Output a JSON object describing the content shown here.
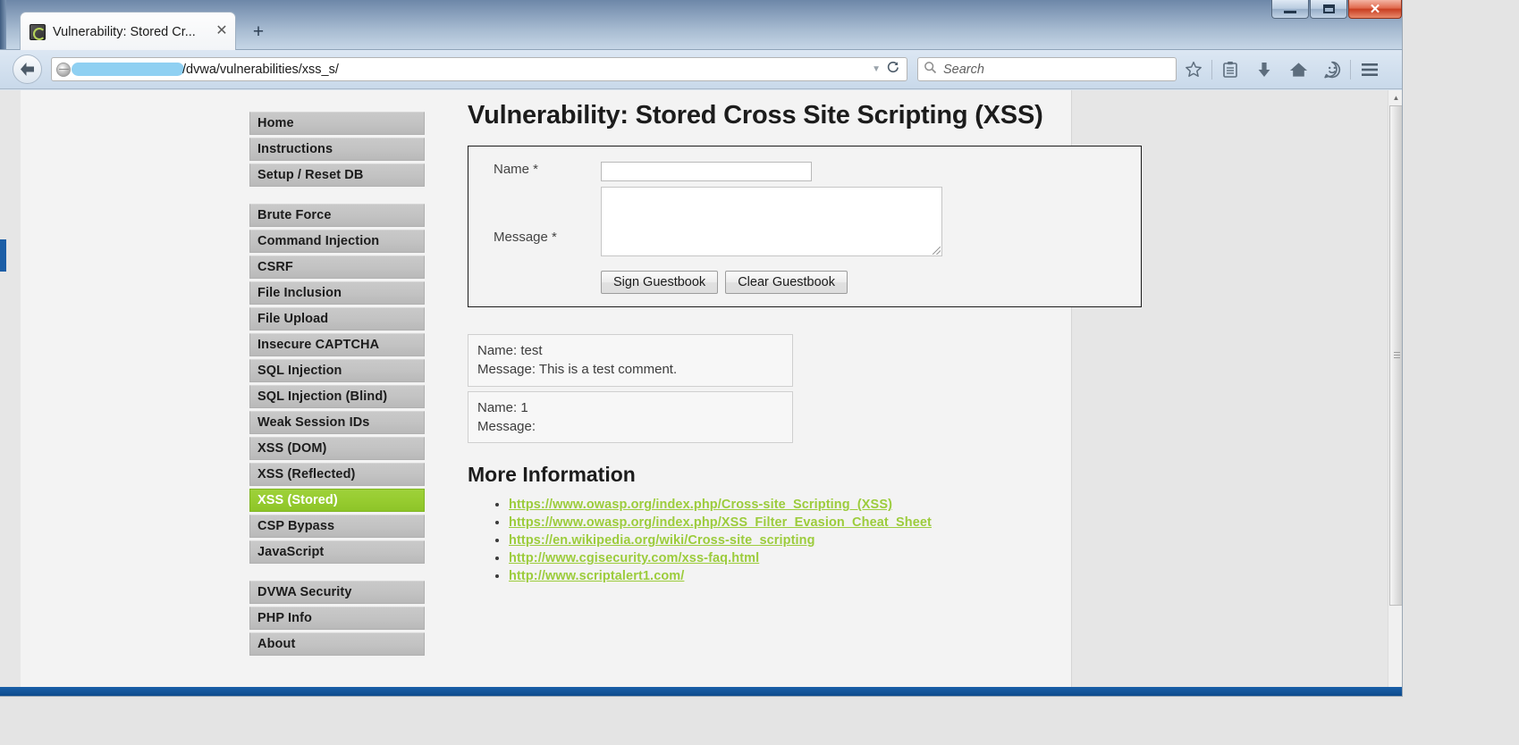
{
  "window": {
    "controls": {
      "minimize": "—",
      "maximize": "□",
      "close": "✕"
    }
  },
  "tabs": [
    {
      "title": "Vulnerability: Stored Cr...",
      "close_label": "✕",
      "favicon": "dvwa-favicon"
    }
  ],
  "new_tab_label": "+",
  "toolbar": {
    "back_label": "back-arrow",
    "url_text": "/dvwa/vulnerabilities/xss_s/",
    "url_redacted": true,
    "url_dropdown": "▼",
    "reload_label": "⟳",
    "search_placeholder": "Search",
    "search_value": "",
    "icons": [
      {
        "name": "bookmark-star-icon",
        "glyph": "☆"
      },
      {
        "name": "reader-list-icon",
        "glyph": "Ὄb"
      },
      {
        "name": "downloads-icon",
        "glyph": "↓"
      },
      {
        "name": "home-icon",
        "glyph": "⌂"
      },
      {
        "name": "sync-smiley-icon",
        "glyph": "☺"
      },
      {
        "name": "menu-hamburger-icon",
        "glyph": "≡"
      }
    ]
  },
  "page": {
    "title": "Vulnerability: Stored Cross Site Scripting (XSS)",
    "sidebar": {
      "groups": [
        {
          "items": [
            {
              "label": "Home",
              "selected": false
            },
            {
              "label": "Instructions",
              "selected": false
            },
            {
              "label": "Setup / Reset DB",
              "selected": false
            }
          ]
        },
        {
          "items": [
            {
              "label": "Brute Force",
              "selected": false
            },
            {
              "label": "Command Injection",
              "selected": false
            },
            {
              "label": "CSRF",
              "selected": false
            },
            {
              "label": "File Inclusion",
              "selected": false
            },
            {
              "label": "File Upload",
              "selected": false
            },
            {
              "label": "Insecure CAPTCHA",
              "selected": false
            },
            {
              "label": "SQL Injection",
              "selected": false
            },
            {
              "label": "SQL Injection (Blind)",
              "selected": false
            },
            {
              "label": "Weak Session IDs",
              "selected": false
            },
            {
              "label": "XSS (DOM)",
              "selected": false
            },
            {
              "label": "XSS (Reflected)",
              "selected": false
            },
            {
              "label": "XSS (Stored)",
              "selected": true
            },
            {
              "label": "CSP Bypass",
              "selected": false
            },
            {
              "label": "JavaScript",
              "selected": false
            }
          ]
        },
        {
          "items": [
            {
              "label": "DVWA Security",
              "selected": false
            },
            {
              "label": "PHP Info",
              "selected": false
            },
            {
              "label": "About",
              "selected": false
            }
          ]
        }
      ]
    },
    "form": {
      "name_label": "Name *",
      "name_value": "",
      "message_label": "Message *",
      "message_value": "",
      "sign_button": "Sign Guestbook",
      "clear_button": "Clear Guestbook"
    },
    "guestbook": [
      {
        "name_line": "Name: test",
        "message_line": "Message: This is a test comment."
      },
      {
        "name_line": "Name: 1",
        "message_line": "Message:"
      }
    ],
    "more_info": {
      "heading": "More Information",
      "links": [
        "https://www.owasp.org/index.php/Cross-site_Scripting_(XSS)",
        "https://www.owasp.org/index.php/XSS_Filter_Evasion_Cheat_Sheet",
        "https://en.wikipedia.org/wiki/Cross-site_scripting",
        "http://www.cgisecurity.com/xss-faq.html",
        "http://www.scriptalert1.com/"
      ]
    }
  },
  "colors": {
    "accent_green": "#9ccc3c",
    "selected_nav": "#97cc30",
    "nav_grey": "#c3c3c3",
    "close_red": "#c83e22"
  },
  "scrollbar": {
    "up_arrow": "▲",
    "down_arrow": "▼"
  }
}
